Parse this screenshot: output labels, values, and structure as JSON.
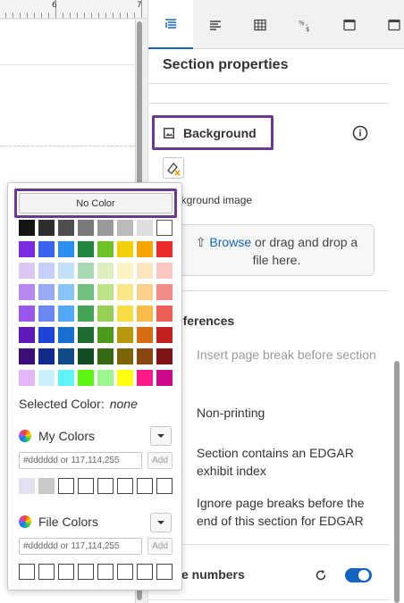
{
  "ruler": {
    "labels": [
      "6",
      "7"
    ]
  },
  "panel": {
    "title": "Section properties",
    "tabs": [
      {
        "name": "tab-section-properties",
        "icon": "section-properties-icon",
        "active": true
      },
      {
        "name": "tab-paragraph",
        "icon": "paragraph-align-icon",
        "active": false
      },
      {
        "name": "tab-table",
        "icon": "table-icon",
        "active": false
      },
      {
        "name": "tab-number-format",
        "icon": "number-format-icon",
        "active": false
      },
      {
        "name": "tab-page-layout",
        "icon": "page-layout-icon",
        "active": false
      },
      {
        "name": "tab-more",
        "icon": "page-layout-icon",
        "active": false
      }
    ],
    "background": {
      "title": "Background",
      "image_label": "Background image",
      "browse_link": "Browse",
      "drop_text_1": " or drag and drop a",
      "drop_text_2": "file here."
    },
    "preferences": {
      "title": "Preferences",
      "items": [
        {
          "label": "Insert page break before section",
          "disabled": true
        },
        {
          "label": "Non-printing",
          "disabled": false
        },
        {
          "label": "Section contains an EDGAR exhibit index",
          "disabled": false
        },
        {
          "label": "Ignore page breaks before the end of this section for EDGAR",
          "disabled": false
        }
      ]
    },
    "line_numbers": {
      "title": "Line numbers",
      "enabled": true
    }
  },
  "picker": {
    "no_color_label": "No Color",
    "palette": [
      [
        "#141414",
        "#2e2e2e",
        "#4f4f4f",
        "#7a7a7a",
        "#9a9a9a",
        "#bbbbbb",
        "#dddddd",
        "#ffffff"
      ],
      [
        "#7b2be0",
        "#3a63f0",
        "#2d8ff0",
        "#23883e",
        "#6fc22a",
        "#f3d10a",
        "#f7a300",
        "#ec2c2c"
      ],
      [
        "#dcc6f6",
        "#c6d0fb",
        "#c3e0fb",
        "#a8d8b1",
        "#ddeebf",
        "#fcf3c5",
        "#fde5bf",
        "#f8c7c4"
      ],
      [
        "#b688f0",
        "#98aaf6",
        "#89c3f7",
        "#72c07e",
        "#bee38a",
        "#f9e78a",
        "#fbd08b",
        "#f38b87"
      ],
      [
        "#9b56ec",
        "#6b87f3",
        "#55a8f5",
        "#42a654",
        "#96d156",
        "#f6dd45",
        "#f9bb4a",
        "#ef5d59"
      ],
      [
        "#5f19b8",
        "#1f43d8",
        "#1b6fcf",
        "#1e6e33",
        "#4e991f",
        "#b8990a",
        "#d66d14",
        "#c21f1f"
      ],
      [
        "#3b0e78",
        "#14298c",
        "#134a8a",
        "#144d23",
        "#346a14",
        "#7a6407",
        "#8a4510",
        "#7e1414"
      ],
      [
        "#e2b6f7",
        "#c9f0fc",
        "#5ff4f7",
        "#5cf512",
        "#9df58d",
        "#ffff14",
        "#ff1a8c",
        "#cc0a8a"
      ]
    ],
    "selected_label": "Selected Color:",
    "selected_value": "none",
    "my_colors": {
      "title": "My Colors",
      "placeholder": "#dddddd or 117,114,255",
      "add_label": "Add",
      "slots": [
        "#e4e0f2",
        "#c9c9c9",
        "",
        "",
        "",
        "",
        "",
        ""
      ]
    },
    "file_colors": {
      "title": "File Colors",
      "placeholder": "#dddddd or 117,114,255",
      "add_label": "Add",
      "slots": [
        "",
        "",
        "",
        "",
        "",
        "",
        "",
        ""
      ]
    }
  },
  "colors": {
    "accent": "#1565c0",
    "focus_outline": "#6b3a8e"
  }
}
